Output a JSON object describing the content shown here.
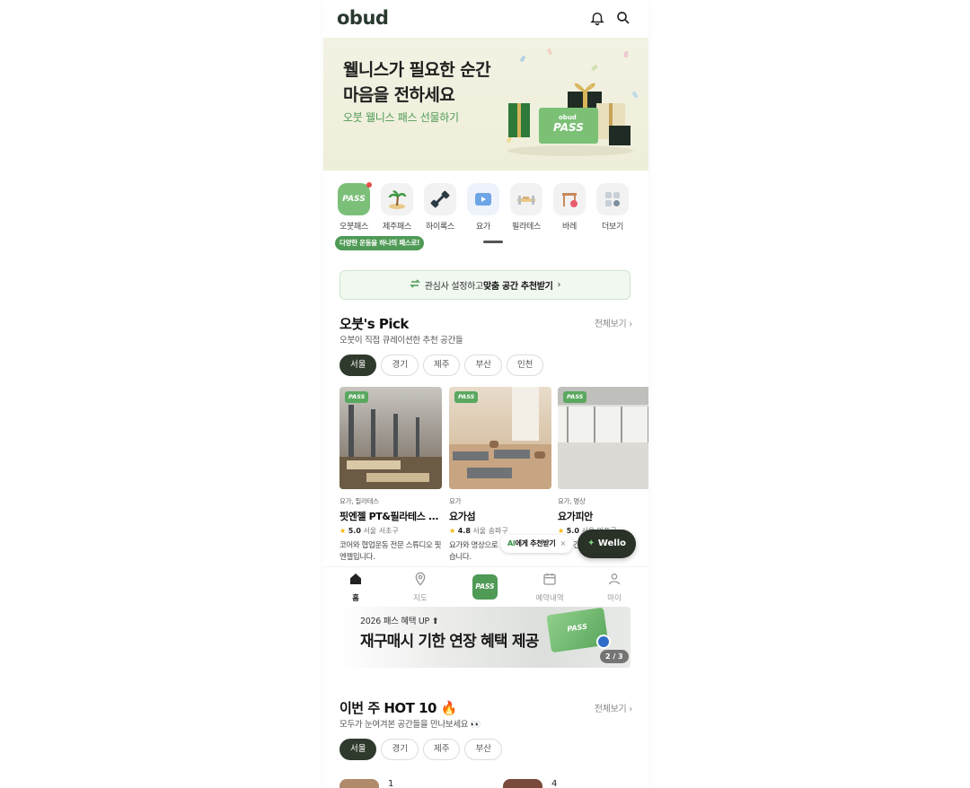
{
  "header": {
    "logo": "obud",
    "icons": [
      "bell-icon",
      "search-icon"
    ]
  },
  "banner": {
    "title": "웰니스가 필요한 순간\n마음을 전하세요",
    "subtitle": "오붓 웰니스 패스 선물하기",
    "card_brand": "obud",
    "card_label": "PASS"
  },
  "categories": {
    "items": [
      {
        "label": "오붓패스",
        "icon": "pass-card-icon",
        "badge": true
      },
      {
        "label": "제주패스",
        "icon": "palm-tree-icon"
      },
      {
        "label": "하이록스",
        "icon": "dumbbell-icon"
      },
      {
        "label": "요가",
        "icon": "yoga-icon",
        "active": true
      },
      {
        "label": "필라테스",
        "icon": "reformer-icon"
      },
      {
        "label": "바레",
        "icon": "barre-icon"
      },
      {
        "label": "더보기",
        "icon": "more-grid-icon"
      }
    ],
    "tooltip": "다양한 운동을 하나의 패스로!"
  },
  "recommend_bar": {
    "text_pre": "관심사 설정하고 ",
    "text_bold": "맞춤 공간 추천받기",
    "chevron": "›"
  },
  "picks": {
    "title": "오붓's Pick",
    "subtitle": "오붓이 직접 큐레이션한 추천 공간들",
    "see_all": "전체보기 ›",
    "regions": [
      "서울",
      "경기",
      "제주",
      "부산",
      "인천"
    ],
    "active_region": "서울",
    "cards": [
      {
        "badge": "PASS",
        "category": "요가, 필라테스",
        "name": "핏엔젤 PT&필라테스 ...",
        "rating": "5.0",
        "location": "서울 서초구",
        "desc": "코어와 협업운동 전문 스튜디오 핏엔젤입니다."
      },
      {
        "badge": "PASS",
        "category": "요가",
        "name": "요가섬",
        "rating": "4.8",
        "location": "서울 송파구",
        "desc": "요가와 명상으로 을 발견하도록 돕습니다."
      },
      {
        "badge": "PASS",
        "category": "요가, 명상",
        "name": "요가피안",
        "rating": "5.0",
        "location": "서울 마포구",
        "desc": "시 공간 요가원 원"
      }
    ]
  },
  "ai_tip": {
    "prefix": "AI",
    "text": "에게 추천받기",
    "close": "×"
  },
  "wello": {
    "spark": "✦",
    "label": "Wello"
  },
  "bottom_nav": {
    "items": [
      {
        "label": "홈",
        "icon": "home-icon",
        "active": true
      },
      {
        "label": "지도",
        "icon": "map-pin-icon"
      },
      {
        "label": "PASS",
        "icon": "pass-icon"
      },
      {
        "label": "예약내역",
        "icon": "calendar-icon"
      },
      {
        "label": "마이",
        "icon": "user-icon"
      }
    ]
  },
  "promo": {
    "top": "2026 패스 혜택 UP ⬆",
    "main": "재구매시 기한 연장 혜택 제공",
    "card_label": "PASS",
    "counter": "2 / 3"
  },
  "hot": {
    "title": "이번 주 HOT 10 🔥",
    "subtitle": "모두가 눈여겨본 공간들을 만나보세요 👀",
    "see_all": "전체보기 ›",
    "regions": [
      "서울",
      "경기",
      "제주",
      "부산"
    ],
    "active_region": "서울",
    "ranks": [
      "1",
      "4"
    ]
  },
  "colors": {
    "brand_green": "#4f9a55",
    "dark": "#2f3a2c",
    "banner_bg": "#f1f0e0"
  }
}
